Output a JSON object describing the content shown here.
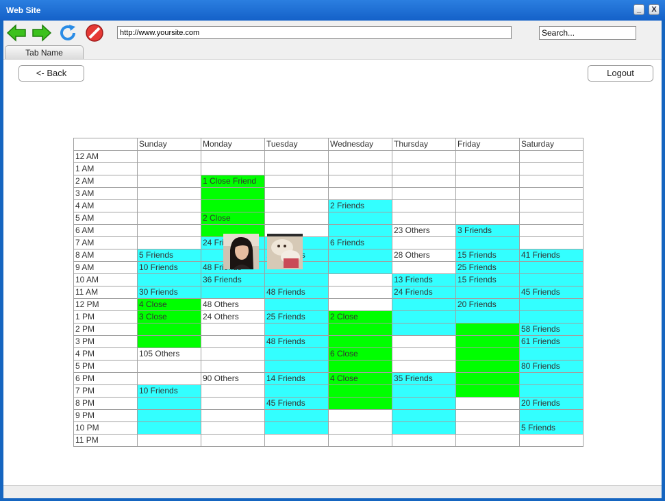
{
  "window": {
    "title": "Web Site",
    "minimize_label": "_",
    "close_label": "X"
  },
  "toolbar": {
    "url": "http://www.yoursite.com",
    "search_placeholder": "Search...",
    "tab_label": "Tab Name"
  },
  "actions": {
    "back_label": "<- Back",
    "logout_label": "Logout"
  },
  "schedule": {
    "days": [
      "Sunday",
      "Monday",
      "Tuesday",
      "Wednesday",
      "Thursday",
      "Friday",
      "Saturday"
    ],
    "rows": [
      {
        "time": "12 AM",
        "cells": [
          {
            "t": "",
            "c": ""
          },
          {
            "t": "",
            "c": ""
          },
          {
            "t": "",
            "c": ""
          },
          {
            "t": "",
            "c": ""
          },
          {
            "t": "",
            "c": ""
          },
          {
            "t": "",
            "c": ""
          },
          {
            "t": "",
            "c": ""
          }
        ]
      },
      {
        "time": "1 AM",
        "cells": [
          {
            "t": "",
            "c": ""
          },
          {
            "t": "",
            "c": ""
          },
          {
            "t": "",
            "c": ""
          },
          {
            "t": "",
            "c": ""
          },
          {
            "t": "",
            "c": ""
          },
          {
            "t": "",
            "c": ""
          },
          {
            "t": "",
            "c": ""
          }
        ]
      },
      {
        "time": "2 AM",
        "cells": [
          {
            "t": "",
            "c": ""
          },
          {
            "t": "1 Close Friend",
            "c": "green"
          },
          {
            "t": "",
            "c": ""
          },
          {
            "t": "",
            "c": ""
          },
          {
            "t": "",
            "c": ""
          },
          {
            "t": "",
            "c": ""
          },
          {
            "t": "",
            "c": ""
          }
        ]
      },
      {
        "time": "3 AM",
        "cells": [
          {
            "t": "",
            "c": ""
          },
          {
            "t": "",
            "c": "green"
          },
          {
            "t": "",
            "c": ""
          },
          {
            "t": "",
            "c": ""
          },
          {
            "t": "",
            "c": ""
          },
          {
            "t": "",
            "c": ""
          },
          {
            "t": "",
            "c": ""
          }
        ]
      },
      {
        "time": "4 AM",
        "cells": [
          {
            "t": "",
            "c": ""
          },
          {
            "t": "",
            "c": "green"
          },
          {
            "t": "",
            "c": ""
          },
          {
            "t": "2 Friends",
            "c": "cyan"
          },
          {
            "t": "",
            "c": ""
          },
          {
            "t": "",
            "c": ""
          },
          {
            "t": "",
            "c": ""
          }
        ]
      },
      {
        "time": "5 AM",
        "cells": [
          {
            "t": "",
            "c": ""
          },
          {
            "t": "2 Close",
            "c": "green"
          },
          {
            "t": "",
            "c": ""
          },
          {
            "t": "",
            "c": "cyan"
          },
          {
            "t": "",
            "c": ""
          },
          {
            "t": "",
            "c": ""
          },
          {
            "t": "",
            "c": ""
          }
        ]
      },
      {
        "time": "6 AM",
        "cells": [
          {
            "t": "",
            "c": ""
          },
          {
            "t": "",
            "c": "green"
          },
          {
            "t": "",
            "c": ""
          },
          {
            "t": "",
            "c": "cyan"
          },
          {
            "t": "23 Others",
            "c": ""
          },
          {
            "t": "3 Friends",
            "c": "cyan"
          },
          {
            "t": "",
            "c": ""
          }
        ]
      },
      {
        "time": "7 AM",
        "cells": [
          {
            "t": "",
            "c": ""
          },
          {
            "t": "24 Friends",
            "c": "cyan"
          },
          {
            "t": "",
            "c": "cyan"
          },
          {
            "t": "6 Friends",
            "c": "cyan"
          },
          {
            "t": "",
            "c": ""
          },
          {
            "t": "",
            "c": "cyan"
          },
          {
            "t": "",
            "c": ""
          }
        ]
      },
      {
        "time": "8 AM",
        "cells": [
          {
            "t": "5 Friends",
            "c": "cyan"
          },
          {
            "t": "",
            "c": "cyan"
          },
          {
            "t": "12 Friends",
            "c": "cyan"
          },
          {
            "t": "",
            "c": "cyan"
          },
          {
            "t": "28 Others",
            "c": ""
          },
          {
            "t": "15 Friends",
            "c": "cyan"
          },
          {
            "t": "41 Friends",
            "c": "cyan"
          }
        ]
      },
      {
        "time": "9 AM",
        "cells": [
          {
            "t": "10 Friends",
            "c": "cyan"
          },
          {
            "t": "48 Friends",
            "c": "cyan"
          },
          {
            "t": "",
            "c": "cyan"
          },
          {
            "t": "",
            "c": "cyan"
          },
          {
            "t": "",
            "c": ""
          },
          {
            "t": "25 Friends",
            "c": "cyan"
          },
          {
            "t": "",
            "c": "cyan"
          }
        ]
      },
      {
        "time": "10 AM",
        "cells": [
          {
            "t": "",
            "c": "cyan"
          },
          {
            "t": "36 Friends",
            "c": "cyan"
          },
          {
            "t": "",
            "c": "cyan"
          },
          {
            "t": "",
            "c": ""
          },
          {
            "t": "13 Friends",
            "c": "cyan"
          },
          {
            "t": "15 Friends",
            "c": "cyan"
          },
          {
            "t": "",
            "c": "cyan"
          }
        ]
      },
      {
        "time": "11 AM",
        "cells": [
          {
            "t": "30 Friends",
            "c": "cyan"
          },
          {
            "t": "",
            "c": "cyan"
          },
          {
            "t": "48 Friends",
            "c": "cyan"
          },
          {
            "t": "",
            "c": ""
          },
          {
            "t": "24 Friends",
            "c": "cyan"
          },
          {
            "t": "",
            "c": "cyan"
          },
          {
            "t": "45 Friends",
            "c": "cyan"
          }
        ]
      },
      {
        "time": "12 PM",
        "cells": [
          {
            "t": "4 Close",
            "c": "green"
          },
          {
            "t": "48 Others",
            "c": ""
          },
          {
            "t": "",
            "c": "cyan"
          },
          {
            "t": "",
            "c": ""
          },
          {
            "t": "",
            "c": "cyan"
          },
          {
            "t": "20 Friends",
            "c": "cyan"
          },
          {
            "t": "",
            "c": "cyan"
          }
        ]
      },
      {
        "time": "1 PM",
        "cells": [
          {
            "t": "3 Close",
            "c": "green"
          },
          {
            "t": "24 Others",
            "c": ""
          },
          {
            "t": "25 Friends",
            "c": "cyan"
          },
          {
            "t": "2 Close",
            "c": "green"
          },
          {
            "t": "",
            "c": "cyan"
          },
          {
            "t": "",
            "c": "cyan"
          },
          {
            "t": "",
            "c": "cyan"
          }
        ]
      },
      {
        "time": "2 PM",
        "cells": [
          {
            "t": "",
            "c": "green"
          },
          {
            "t": "",
            "c": ""
          },
          {
            "t": "",
            "c": "cyan"
          },
          {
            "t": "",
            "c": "green"
          },
          {
            "t": "",
            "c": "cyan"
          },
          {
            "t": "",
            "c": "green"
          },
          {
            "t": "58 Friends",
            "c": "cyan"
          }
        ]
      },
      {
        "time": "3 PM",
        "cells": [
          {
            "t": "",
            "c": "green"
          },
          {
            "t": "",
            "c": ""
          },
          {
            "t": "48 Friends",
            "c": "cyan"
          },
          {
            "t": "",
            "c": "green"
          },
          {
            "t": "",
            "c": ""
          },
          {
            "t": "",
            "c": "green"
          },
          {
            "t": "61 Friends",
            "c": "cyan"
          }
        ]
      },
      {
        "time": "4 PM",
        "cells": [
          {
            "t": "105 Others",
            "c": ""
          },
          {
            "t": "",
            "c": ""
          },
          {
            "t": "",
            "c": "cyan"
          },
          {
            "t": "6 Close",
            "c": "green"
          },
          {
            "t": "",
            "c": ""
          },
          {
            "t": "",
            "c": "green"
          },
          {
            "t": "",
            "c": "cyan"
          }
        ]
      },
      {
        "time": "5 PM",
        "cells": [
          {
            "t": "",
            "c": ""
          },
          {
            "t": "",
            "c": ""
          },
          {
            "t": "",
            "c": "cyan"
          },
          {
            "t": "",
            "c": "green"
          },
          {
            "t": "",
            "c": ""
          },
          {
            "t": "",
            "c": "green"
          },
          {
            "t": "80 Friends",
            "c": "cyan"
          }
        ]
      },
      {
        "time": "6 PM",
        "cells": [
          {
            "t": "",
            "c": ""
          },
          {
            "t": "90 Others",
            "c": ""
          },
          {
            "t": "14 Friends",
            "c": "cyan"
          },
          {
            "t": "4 Close",
            "c": "green"
          },
          {
            "t": "35 Friends",
            "c": "cyan"
          },
          {
            "t": "",
            "c": "green"
          },
          {
            "t": "",
            "c": "cyan"
          }
        ]
      },
      {
        "time": "7 PM",
        "cells": [
          {
            "t": "10 Friends",
            "c": "cyan"
          },
          {
            "t": "",
            "c": ""
          },
          {
            "t": "",
            "c": "cyan"
          },
          {
            "t": "",
            "c": "green"
          },
          {
            "t": "",
            "c": "cyan"
          },
          {
            "t": "",
            "c": "green"
          },
          {
            "t": "",
            "c": "cyan"
          }
        ]
      },
      {
        "time": "8 PM",
        "cells": [
          {
            "t": "",
            "c": "cyan"
          },
          {
            "t": "",
            "c": ""
          },
          {
            "t": "45 Friends",
            "c": "cyan"
          },
          {
            "t": "",
            "c": "green"
          },
          {
            "t": "",
            "c": "cyan"
          },
          {
            "t": "",
            "c": ""
          },
          {
            "t": "20 Friends",
            "c": "cyan"
          }
        ]
      },
      {
        "time": "9 PM",
        "cells": [
          {
            "t": "",
            "c": "cyan"
          },
          {
            "t": "",
            "c": ""
          },
          {
            "t": "",
            "c": "cyan"
          },
          {
            "t": "",
            "c": ""
          },
          {
            "t": "",
            "c": "cyan"
          },
          {
            "t": "",
            "c": ""
          },
          {
            "t": "",
            "c": "cyan"
          }
        ]
      },
      {
        "time": "10 PM",
        "cells": [
          {
            "t": "",
            "c": "cyan"
          },
          {
            "t": "",
            "c": ""
          },
          {
            "t": "",
            "c": "cyan"
          },
          {
            "t": "",
            "c": ""
          },
          {
            "t": "",
            "c": "cyan"
          },
          {
            "t": "",
            "c": ""
          },
          {
            "t": "5 Friends",
            "c": "cyan"
          }
        ]
      },
      {
        "time": "11 PM",
        "cells": [
          {
            "t": "",
            "c": ""
          },
          {
            "t": "",
            "c": ""
          },
          {
            "t": "",
            "c": ""
          },
          {
            "t": "",
            "c": ""
          },
          {
            "t": "",
            "c": ""
          },
          {
            "t": "",
            "c": ""
          },
          {
            "t": "",
            "c": ""
          }
        ]
      }
    ]
  },
  "colors": {
    "cyan": "#33ffff",
    "green": "#00ff00",
    "titlebar": "#1461c8"
  },
  "icons": [
    "back-arrow-icon",
    "forward-arrow-icon",
    "refresh-icon",
    "stop-icon",
    "avatar-photo",
    "pet-photo"
  ]
}
